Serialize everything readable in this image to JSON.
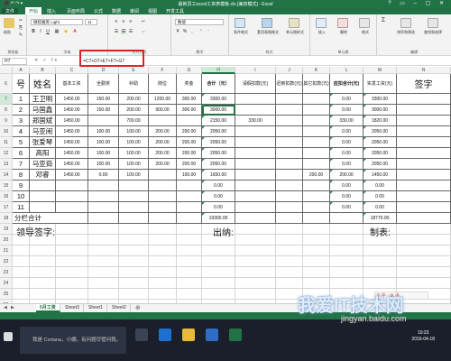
{
  "window": {
    "title": "最新员工excel工资表模板.xls [兼容模式] - Excel",
    "quick_access": "⬛ ↶ ↷ ▾"
  },
  "ribbon_tabs": [
    "文件",
    "开始",
    "插入",
    "页面布局",
    "公式",
    "数据",
    "审阅",
    "视图",
    "开发工具"
  ],
  "ribbon": {
    "paste_label": "粘贴",
    "clipboard_label": "剪贴板",
    "font_name": "微软雅黑 Light",
    "font_size": "11",
    "font_label": "字体",
    "align_label": "对齐方式",
    "number_format": "数值",
    "number_label": "数字",
    "styles": [
      "条件格式",
      "套用表格格式",
      "单元格样式"
    ],
    "styles_label": "样式",
    "cells": [
      "插入",
      "删除",
      "格式"
    ],
    "cells_label": "单元格",
    "editing": [
      "排序和筛选",
      "查找和选择"
    ],
    "editing_label": "编辑"
  },
  "formula_bar": {
    "name_box": "H7",
    "fx": "✕ ✓ fx",
    "formula": "=C7+D7+E7+F7+G7"
  },
  "columns": [
    "A",
    "B",
    "C",
    "D",
    "E",
    "F",
    "G",
    "H",
    "I",
    "J",
    "K",
    "L",
    "M",
    "N"
  ],
  "rows": [
    "6",
    "7",
    "8",
    "9",
    "10",
    "11",
    "12",
    "13",
    "14",
    "15",
    "16",
    "17",
    "18",
    "19",
    "20",
    "21",
    "22",
    "23",
    "24",
    "25",
    "26",
    "27"
  ],
  "table": {
    "seq_header": "号",
    "name_header": "姓名",
    "headers": {
      "c": "基本工资",
      "d": "全勤奖",
      "e": "补助",
      "f": "岗位",
      "g": "奖金",
      "h": "合计（元）",
      "i": "请假扣款(元)",
      "j": "迟到扣款(元)",
      "k": "其它扣款(元)",
      "l": "应扣合计(元)",
      "m": "实发工资(元)",
      "n": "签字"
    },
    "data_rows": [
      {
        "seq": "1",
        "name": "王卫明",
        "c": "1450.00",
        "d": "150.00",
        "e": "200.00",
        "f": "1200.00",
        "g": "300.00",
        "h": "3300.00",
        "i": "",
        "j": "",
        "k": "",
        "l": "0.00",
        "m": "3300.00"
      },
      {
        "seq": "2",
        "name": "马国鑫",
        "c": "1450.00",
        "d": "150.00",
        "e": "200.00",
        "f": "900.00",
        "g": "300.00",
        "h": "3000.00",
        "i": "",
        "j": "",
        "k": "",
        "l": "0.00",
        "m": "3000.00"
      },
      {
        "seq": "3",
        "name": "郑国斌",
        "c": "1450.00",
        "d": "",
        "e": "700.00",
        "f": "",
        "g": "",
        "h": "2150.00",
        "i": "330.00",
        "j": "",
        "k": "",
        "l": "330.00",
        "m": "1820.00"
      },
      {
        "seq": "4",
        "name": "马亚闹",
        "c": "1450.00",
        "d": "100.00",
        "e": "100.00",
        "f": "200.00",
        "g": "200.00",
        "h": "2050.00",
        "i": "",
        "j": "",
        "k": "",
        "l": "0.00",
        "m": "2050.00"
      },
      {
        "seq": "5",
        "name": "张爱琴",
        "c": "1450.00",
        "d": "100.00",
        "e": "100.00",
        "f": "200.00",
        "g": "200.00",
        "h": "2050.00",
        "i": "",
        "j": "",
        "k": "",
        "l": "0.00",
        "m": "2050.00"
      },
      {
        "seq": "6",
        "name": "高阳",
        "c": "1450.00",
        "d": "100.00",
        "e": "100.00",
        "f": "200.00",
        "g": "200.00",
        "h": "2050.00",
        "i": "",
        "j": "",
        "k": "",
        "l": "0.00",
        "m": "2050.00"
      },
      {
        "seq": "7",
        "name": "马亚茹",
        "c": "1450.00",
        "d": "100.00",
        "e": "100.00",
        "f": "200.00",
        "g": "200.00",
        "h": "2050.00",
        "i": "",
        "j": "",
        "k": "",
        "l": "0.00",
        "m": "2050.00"
      },
      {
        "seq": "8",
        "name": "邓睿",
        "c": "1450.00",
        "d": "0.00",
        "e": "100.00",
        "f": "",
        "g": "100.00",
        "h": "1650.00",
        "i": "",
        "j": "",
        "k": "200.00",
        "l": "200.00",
        "m": "1450.00"
      },
      {
        "seq": "9",
        "name": "",
        "c": "",
        "d": "",
        "e": "",
        "f": "",
        "g": "",
        "h": "0.00",
        "i": "",
        "j": "",
        "k": "",
        "l": "0.00",
        "m": "0.00"
      },
      {
        "seq": "10",
        "name": "",
        "c": "",
        "d": "",
        "e": "",
        "f": "",
        "g": "",
        "h": "0.00",
        "i": "",
        "j": "",
        "k": "",
        "l": "0.00",
        "m": "0.00"
      },
      {
        "seq": "11",
        "name": "",
        "c": "",
        "d": "",
        "e": "",
        "f": "",
        "g": "",
        "h": "0.00",
        "i": "",
        "j": "",
        "k": "",
        "l": "0.00",
        "m": "0.00"
      }
    ],
    "total_label": "分栏合计",
    "total_h": "19300.00",
    "total_m": "18770.00"
  },
  "signatures": {
    "leader": "领导签字:",
    "cashier": "出纳:",
    "maker": "制表:"
  },
  "sheets": [
    "5月工资",
    "Sheet3",
    "Sheet1",
    "Sheet2"
  ],
  "taskbar": {
    "search_placeholder": "我是 Cortana，小娜。有问题尽管问我。",
    "time": "10:23",
    "date": "2016-04-18"
  },
  "watermark": "我爱IT技术网",
  "watermark_url": "jingyan.baidu.com",
  "badge": "S 中 · ⚙ 半",
  "colors": {
    "excel_green": "#217346",
    "highlight": "#e02020"
  }
}
